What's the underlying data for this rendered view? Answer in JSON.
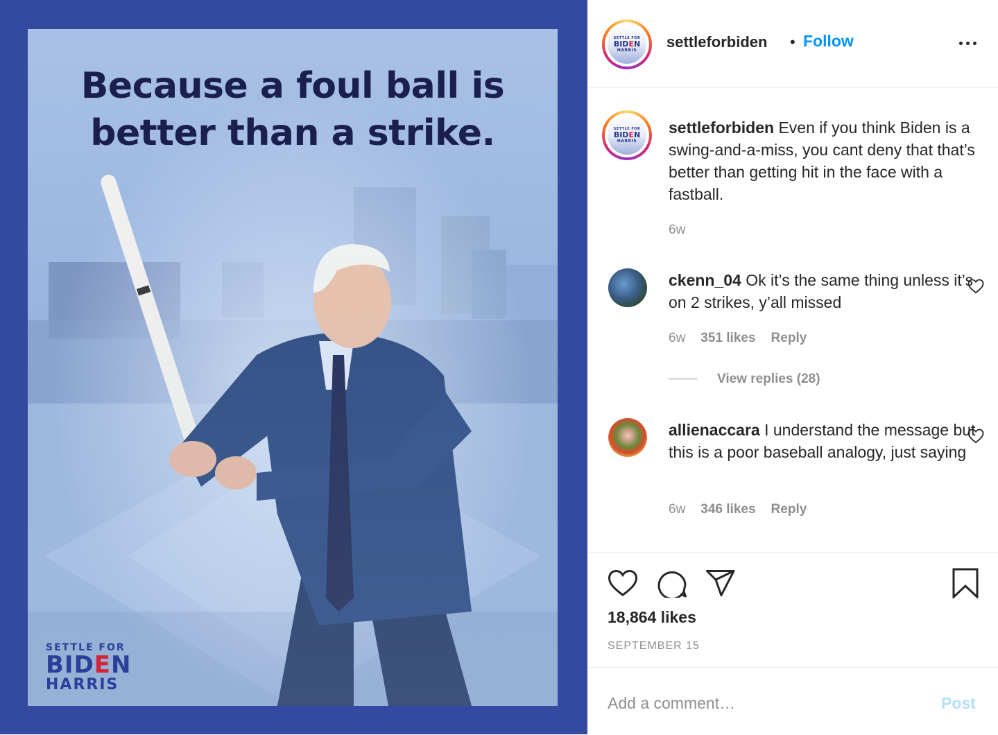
{
  "post": {
    "image": {
      "headline_line1": "Because a foul ball is",
      "headline_line2": "better than a strike.",
      "brand_top": "SETTLE FOR",
      "brand_mid_a": "BID",
      "brand_mid_e": "E",
      "brand_mid_b": "N",
      "brand_bottom": "HARRIS"
    }
  },
  "header": {
    "username": "settleforbiden",
    "separator": "•",
    "follow_label": "Follow"
  },
  "avatar_logo": {
    "top": "SETTLE FOR",
    "mid_a": "BID",
    "mid_e": "E",
    "mid_b": "N",
    "bottom": "HARRIS"
  },
  "caption": {
    "username": "settleforbiden",
    "text": " Even if you think Biden is a swing-and-a-miss, you cant deny that that’s better than getting hit in the face with a fastball.",
    "time": "6w"
  },
  "comments": [
    {
      "username": "ckenn_04",
      "text": " Ok it’s the same thing unless it’s on 2 strikes, y’all missed",
      "time": "6w",
      "likes": "351 likes",
      "reply_label": "Reply",
      "view_replies": "View replies (28)"
    },
    {
      "username": "allienaccara",
      "text": " I understand the message but this is a poor baseball analogy, just saying",
      "time": "6w",
      "likes": "346 likes",
      "reply_label": "Reply"
    }
  ],
  "actions": {
    "likes": "18,864 likes",
    "date": "SEPTEMBER 15"
  },
  "add_comment": {
    "placeholder": "Add a comment…",
    "post_label": "Post"
  },
  "colors": {
    "follow": "#0095f6",
    "post_disabled": "#b3dffc",
    "media_bg": "#3449a0"
  }
}
